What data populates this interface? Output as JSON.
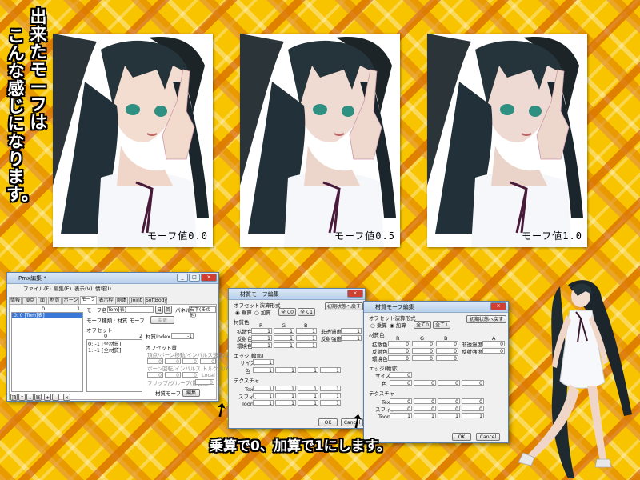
{
  "side_title": [
    "出来たモーフは",
    "こんな感じになります。"
  ],
  "photos": [
    {
      "caption": "モーフ値0.0"
    },
    {
      "caption": "モーフ値0.5"
    },
    {
      "caption": "モーフ値1.0"
    }
  ],
  "bottom_caption": "乗算で0、加算で1にします。",
  "main_window": {
    "title": "Pmx編集 *",
    "menu": [
      "ファイル(F)",
      "編集(E)",
      "表示(V)",
      "情報(I)"
    ],
    "tabs": [
      "情報",
      "頂点",
      "面",
      "材質",
      "ボーン",
      "モーフ",
      "表示枠",
      "剛体",
      "Joint",
      "SoftBody"
    ],
    "list_counter": "0",
    "list_value": "1",
    "list_item": "0: 0 [Tom]表]",
    "morph_name_label": "モーフ名",
    "morph_name_value": "Tom]表]",
    "jp_btn": "日",
    "en_btn": "英",
    "panel_label": "パネル",
    "panel_value": "右下(その他)",
    "morph_kind_label": "モーフ種類 : 材質 モーフ",
    "change_label": "変更",
    "offset_label": "オフセット",
    "offset_count": "0",
    "offset_count2": "2",
    "offset_items": [
      "0: -1 [全材質]",
      "1: -1 [全材質]"
    ],
    "material_index_label": "材質Index :",
    "material_index_value": "-1",
    "offset_amount_label": "オフセット量",
    "vertex_uv_label": "頂点/ボーン移動/インパルス速度/UV",
    "bone_rotation_label": "ボーン回転/インパルス トルク(X/Y/Z)",
    "local_label": "Local",
    "flip_label": "フリップ/グループ(影響度)",
    "material_morph_label": "材質モーフ",
    "edit_btn": "編集",
    "grid_zero": "0",
    "bottom_buttons": [
      "頂",
      "↑",
      "↓",
      "底",
      "+",
      "-",
      "×"
    ]
  },
  "mat_window": {
    "title": "材質モーフ編集",
    "calc_label": "オフセット演算形式",
    "mul_label": "乗算",
    "add_label": "加算",
    "all0_btn": "全て0",
    "all1_btn": "全て1",
    "reset_btn": "初期状態へ戻す",
    "material_colors": "材質色",
    "rgba": [
      "R",
      "G",
      "B",
      "A"
    ],
    "diffuse": "拡散色",
    "specular": "反射色",
    "ambient": "環境色",
    "opacity_label": "非透過度",
    "spec_strength_label": "反射強度",
    "edge_label": "エッジ(輪郭)",
    "size_label": "サイズ",
    "color_label": "色",
    "texture_label": "テクスチャ",
    "tex_label": "Tex",
    "sphere_label": "スフィア",
    "toon_label": "Toon",
    "ok_btn": "OK",
    "cancel_btn": "Cancel",
    "val0": "0",
    "val1": "1"
  }
}
